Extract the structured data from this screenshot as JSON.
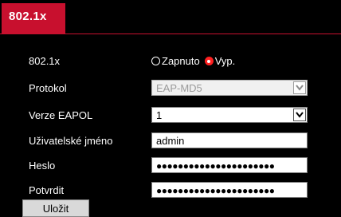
{
  "tab": {
    "label": "802.1x"
  },
  "rows": {
    "enable": {
      "label": "802.1x",
      "on_label": "Zapnuto",
      "off_label": "Vyp.",
      "selected": "Vyp."
    },
    "protocol": {
      "label": "Protokol",
      "value": "EAP-MD5"
    },
    "eapol": {
      "label": "Verze EAPOL",
      "value": "1"
    },
    "username": {
      "label": "Uživatelské jméno",
      "value": "admin"
    },
    "password": {
      "label": "Heslo",
      "value": "●●●●●●●●●●●●●●●●●●●●●●"
    },
    "confirm": {
      "label": "Potvrdit",
      "value": "●●●●●●●●●●●●●●●●●●●●●●"
    }
  },
  "save_button": {
    "label": "Uložit"
  },
  "colors": {
    "accent": "#c8102e",
    "radio_selected": "#ff2020"
  },
  "icons": {
    "dropdown": "chevron-down-icon"
  }
}
